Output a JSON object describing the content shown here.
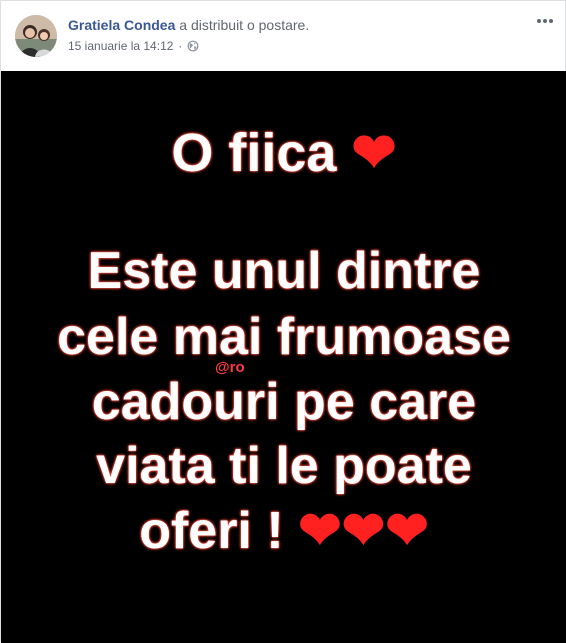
{
  "post": {
    "author": "Gratiela Condea",
    "action": " a distribuit o postare.",
    "timestamp": "15 ianuarie la 14:12",
    "separator": "·",
    "privacy_icon": "globe-icon",
    "more_icon": "more-options-icon"
  },
  "image": {
    "lines": [
      "O fiica",
      "Este unul dintre",
      "cele mai frumoase",
      "cadouri pe care",
      "viata ti le poate",
      "oferi !"
    ],
    "title_heart": "❤",
    "final_hearts": "❤❤❤",
    "watermark": "@ro"
  },
  "colors": {
    "author_link": "#385898",
    "meta_text": "#616770",
    "image_background": "#000000",
    "text_glow": "#ff4b3a",
    "heart": "#ff2020"
  }
}
